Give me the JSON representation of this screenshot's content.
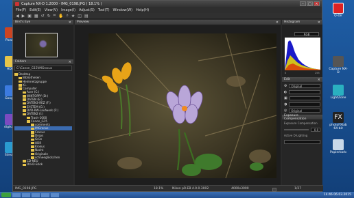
{
  "window": {
    "title": "Capture NX-D 1.2000 - IMG_0198.JPG ( 18.1% )",
    "menu": [
      "File(F)",
      "Edit(E)",
      "View(V)",
      "Image(I)",
      "Adjust(S)",
      "Tool(T)",
      "Window(W)",
      "Help(H)"
    ]
  },
  "panels": {
    "birdseye_title": "Bird's Eye",
    "preview_title": "Preview",
    "folders_title": "Folders",
    "histogram_title": "Histogram",
    "histogram_channel": "RGB",
    "histogram_min": "0",
    "histogram_max": "255",
    "edit_title": "Edit",
    "exposure_title": "Exposure Compensation",
    "exposure_label": "Exposure Compensation",
    "exposure_value": "0.0",
    "active_dlighting_label": "Active D-Lighting",
    "original_option": "Original"
  },
  "folders": {
    "path": "C:\\Canon_G15\\IMGrocus",
    "tree": [
      {
        "label": "Desktop",
        "indent": 0
      },
      {
        "label": "Bibliotheken",
        "indent": 1
      },
      {
        "label": "Heimnetzgruppe",
        "indent": 1
      },
      {
        "label": "Kl..",
        "indent": 1
      },
      {
        "label": "Computer",
        "indent": 1
      },
      {
        "label": "Acer (C:)",
        "indent": 2
      },
      {
        "label": "WINTOPPY (D:)",
        "indent": 2
      },
      {
        "label": "DATEN (E:)",
        "indent": 2
      },
      {
        "label": "DATEN3-REZ (F:)",
        "indent": 2
      },
      {
        "label": "SYSTEM (G:)",
        "indent": 2
      },
      {
        "label": "DVD-RW-Laufwerk (F:)",
        "indent": 2
      },
      {
        "label": "DATEN2 (I:)",
        "indent": 2
      },
      {
        "label": "Trash-1000",
        "indent": 3
      },
      {
        "label": "Canon_G15",
        "indent": 3
      },
      {
        "label": "comments",
        "indent": 4
      },
      {
        "label": "IMGrocus",
        "indent": 4,
        "selected": true
      },
      {
        "label": "Crocus",
        "indent": 4
      },
      {
        "label": "Drops",
        "indent": 4
      },
      {
        "label": "Grün",
        "indent": 4
      },
      {
        "label": "HDR",
        "indent": 4
      },
      {
        "label": "Krokus",
        "indent": 4
      },
      {
        "label": "Nacht",
        "indent": 4
      },
      {
        "label": "Originale",
        "indent": 4
      },
      {
        "label": "schneeglöckchen",
        "indent": 4
      },
      {
        "label": "CD-NEU",
        "indent": 2
      },
      {
        "label": "Olli-D-Stick",
        "indent": 2
      }
    ]
  },
  "status": {
    "filename": "IMG_0198.JPG",
    "zoom": "18.1%",
    "info": "Nikon pR-EB 4.0.0.3002",
    "dims": "4000x3000",
    "page": "1/27"
  },
  "desktop_icons": [
    {
      "label": "Picasa"
    },
    {
      "label": "HDR"
    },
    {
      "label": "Google"
    },
    {
      "label": "digikam"
    },
    {
      "label": "Stream"
    },
    {
      "label": "Q-Dir"
    },
    {
      "label": "Capture NX-D"
    },
    {
      "label": "LightZone"
    },
    {
      "label": "photoFXlab 64-bit"
    },
    {
      "label": "Papierkorb"
    }
  ],
  "taskbar": {
    "clock": "14:46",
    "date": "06.03.2015"
  },
  "icons": {
    "close": "close-icon",
    "settings": "gear-icon"
  }
}
